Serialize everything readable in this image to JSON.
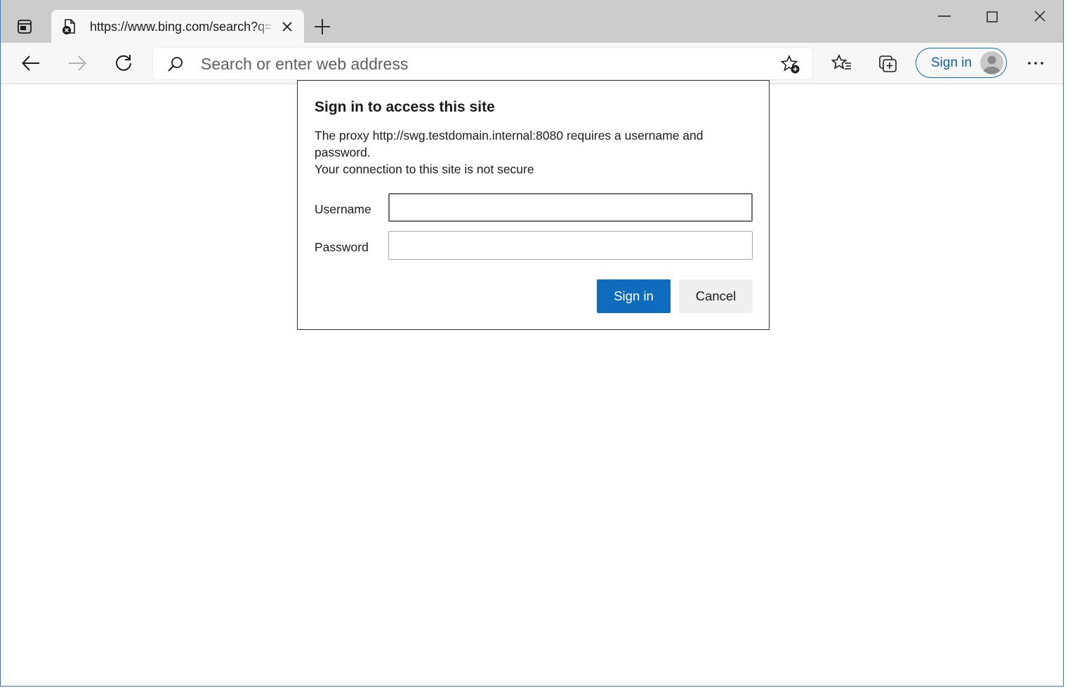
{
  "browser": {
    "tab": {
      "title": "https://www.bing.com/search?q=",
      "favicon": "page-error-icon"
    },
    "address_bar": {
      "placeholder": "Search or enter web address",
      "value": ""
    },
    "profile": {
      "label": "Sign in"
    },
    "accent_color": "#0f6cbd"
  },
  "dialog": {
    "title": "Sign in to access this site",
    "message_line1": "The proxy http://swg.testdomain.internal:8080 requires a username and password.",
    "message_line2": "Your connection to this site is not secure",
    "username_label": "Username",
    "username_value": "",
    "password_label": "Password",
    "password_value": "",
    "signin_label": "Sign in",
    "cancel_label": "Cancel"
  }
}
